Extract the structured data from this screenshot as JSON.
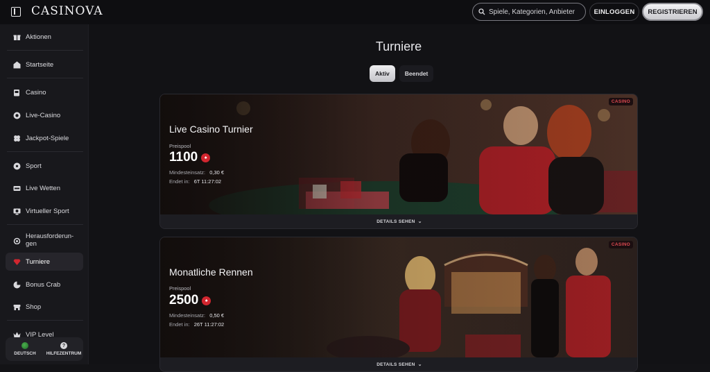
{
  "header": {
    "logo": "CASINOVA",
    "search_placeholder": "Spiele, Kategorien, Anbieter",
    "login_label": "EINLOGGEN",
    "register_label": "REGISTRIEREN"
  },
  "sidebar": {
    "items": [
      {
        "label": "Aktionen",
        "icon": "gift-icon"
      },
      {
        "label": "Startseite",
        "icon": "home-icon"
      },
      {
        "label": "Casino",
        "icon": "slot-machine-icon"
      },
      {
        "label": "Live-Casino",
        "icon": "chip-icon"
      },
      {
        "label": "Jackpot-Spiele",
        "icon": "clover-icon"
      },
      {
        "label": "Sport",
        "icon": "soccer-ball-icon"
      },
      {
        "label": "Live Wetten",
        "icon": "live-icon"
      },
      {
        "label": "Virtueller Sport",
        "icon": "virtual-sport-icon"
      },
      {
        "label": "Herausforderun-\ngen",
        "icon": "medal-icon"
      },
      {
        "label": "Turniere",
        "icon": "gem-icon"
      },
      {
        "label": "Bonus Crab",
        "icon": "crab-icon"
      },
      {
        "label": "Shop",
        "icon": "shop-icon"
      },
      {
        "label": "VIP Level",
        "icon": "crown-icon"
      }
    ],
    "active_item": "Turniere",
    "footer": {
      "language_label": "DEUTSCH",
      "help_label": "HILFEZENTRUM"
    }
  },
  "main": {
    "title": "Turniere",
    "tabs": [
      {
        "label": "Aktiv",
        "active": true
      },
      {
        "label": "Beendet",
        "active": false
      }
    ],
    "tournaments": [
      {
        "badge": "CASINO",
        "title": "Live Casino Turnier",
        "prize_label": "Preispool",
        "prize_value": "1100",
        "min_bet_label": "Mindesteinsatz:",
        "min_bet_value": "0,30 €",
        "ends_label": "Endet in:",
        "ends_value": "6T 11:27:02",
        "details_label": "DETAILS SEHEN"
      },
      {
        "badge": "CASINO",
        "title": "Monatliche Rennen",
        "prize_label": "Preispool",
        "prize_value": "2500",
        "min_bet_label": "Mindesteinsatz:",
        "min_bet_value": "0,50 €",
        "ends_label": "Endet in:",
        "ends_value": "26T 11:27:02",
        "details_label": "DETAILS SEHEN"
      }
    ]
  },
  "colors": {
    "background": "#131316",
    "sidebar": "#18181c",
    "accent_red": "#d1262f",
    "badge_text": "#e04a52"
  }
}
